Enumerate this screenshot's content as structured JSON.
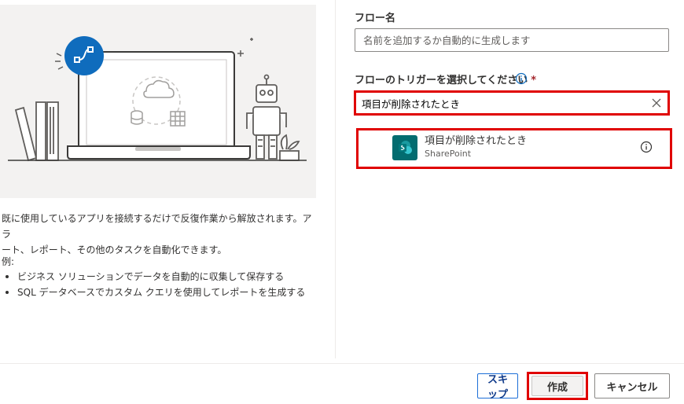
{
  "left_panel": {
    "description_line1": "既に使用しているアプリを接続するだけで反復作業から解放されます。アラ",
    "description_line2": "ート、レポート、その他のタスクを自動化できます。",
    "examples_title": "例:",
    "examples": [
      "ビジネス ソリューションでデータを自動的に収集して保存する",
      "SQL データベースでカスタム クエリを使用してレポートを生成する"
    ]
  },
  "form": {
    "flow_name_label": "フロー名",
    "flow_name_placeholder": "名前を追加するか自動的に生成します",
    "trigger_label": "フローのトリガーを選択してください",
    "required_mark": "*",
    "trigger_search_value": "項目が削除されたとき",
    "trigger_option": {
      "title": "項目が削除されたとき",
      "connector": "SharePoint",
      "icon": "sharepoint-icon"
    }
  },
  "footer": {
    "skip_label": "スキップ",
    "create_label": "作成",
    "cancel_label": "キャンセル"
  },
  "colors": {
    "highlight_red": "#e00000",
    "accent_blue": "#0f6cbd",
    "sharepoint_teal": "#036c70"
  }
}
